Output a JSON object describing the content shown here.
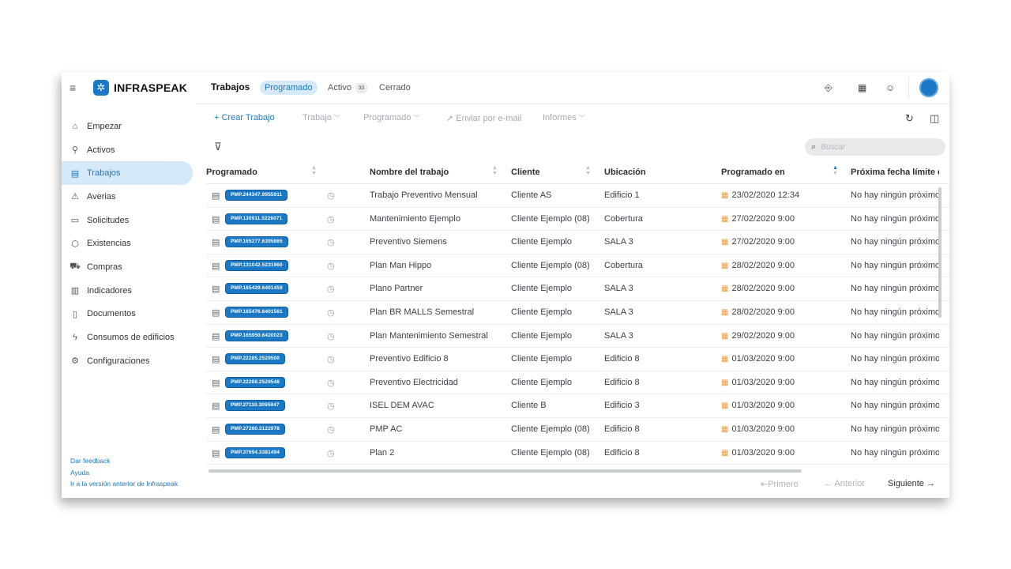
{
  "brand": {
    "name": "INFRASPEAK"
  },
  "sidebar": {
    "items": [
      {
        "label": "Empezar",
        "icon": "home-icon",
        "glyph": "⌂"
      },
      {
        "label": "Activos",
        "icon": "wrench-icon",
        "glyph": "⚲"
      },
      {
        "label": "Trabajos",
        "icon": "clipboard-icon",
        "glyph": "▤",
        "active": true
      },
      {
        "label": "Averias",
        "icon": "warning-icon",
        "glyph": "⚠"
      },
      {
        "label": "Solicitudes",
        "icon": "message-icon",
        "glyph": "▭"
      },
      {
        "label": "Existencias",
        "icon": "boxes-icon",
        "glyph": "⬡"
      },
      {
        "label": "Compras",
        "icon": "cart-icon",
        "glyph": "⛟"
      },
      {
        "label": "Indicadores",
        "icon": "bar-chart-icon",
        "glyph": "▥"
      },
      {
        "label": "Documentos",
        "icon": "document-icon",
        "glyph": "▯"
      },
      {
        "label": "Consumos de edificios",
        "icon": "lightning-icon",
        "glyph": "ϟ"
      },
      {
        "label": "Configuraciones",
        "icon": "gear-icon",
        "glyph": "⚙"
      }
    ],
    "footer": {
      "feedback": "Dar feedback",
      "help": "Ayuda",
      "previous_version": "Ir a la versión anterior de Infraspeak"
    }
  },
  "header": {
    "title": "Trabajos",
    "tabs": {
      "scheduled": "Programado",
      "active": "Activo",
      "active_count": "33",
      "closed": "Cerrado"
    }
  },
  "toolbar": {
    "create": "+ Crear Trabajo",
    "job": "Trabajo",
    "scheduled": "Programado",
    "email": "Enviar por e-mail",
    "reports": "Informes"
  },
  "search": {
    "placeholder": "Buscar"
  },
  "table": {
    "headers": {
      "scheduled": "Programado",
      "name": "Nombre del trabajo",
      "client": "Cliente",
      "location": "Ubicación",
      "scheduled_at": "Programado en",
      "next_deadline": "Próxima fecha límite de"
    },
    "rows": [
      {
        "code": "PMP.244347.9955911",
        "name": "Trabajo Preventivo Mensual",
        "client": "Cliente AS",
        "location": "Edificio 1",
        "date": "23/02/2020 12:34",
        "next": "No hay ningún próximo"
      },
      {
        "code": "PMP.130911.5226071",
        "name": "Mantenimiento Ejemplo",
        "client": "Cliente Ejemplo (08)",
        "location": "Cobertura",
        "date": "27/02/2020 9:00",
        "next": "No hay ningún próximo"
      },
      {
        "code": "PMP.165277.6395865",
        "name": "Preventivo Siemens",
        "client": "Cliente Ejemplo",
        "location": "SALA 3",
        "date": "27/02/2020 9:00",
        "next": "No hay ningún próximo"
      },
      {
        "code": "PMP.131042.5231960",
        "name": "Plan Man Hippo",
        "client": "Cliente Ejemplo (08)",
        "location": "Cobertura",
        "date": "28/02/2020 9:00",
        "next": "No hay ningún próximo"
      },
      {
        "code": "PMP.165429.6401459",
        "name": "Plano Partner",
        "client": "Cliente Ejemplo",
        "location": "SALA 3",
        "date": "28/02/2020 9:00",
        "next": "No hay ningún próximo"
      },
      {
        "code": "PMP.165476.6401561",
        "name": "Plan BR MALLS Semestral",
        "client": "Cliente Ejemplo",
        "location": "SALA 3",
        "date": "28/02/2020 9:00",
        "next": "No hay ningún próximo"
      },
      {
        "code": "PMP.165950.6420023",
        "name": "Plan Mantenimiento Semestral",
        "client": "Cliente Ejemplo",
        "location": "SALA 3",
        "date": "29/02/2020 9:00",
        "next": "No hay ningún próximo"
      },
      {
        "code": "PMP.22285.2529500",
        "name": "Preventivo Edificio 8",
        "client": "Cliente Ejemplo",
        "location": "Edificio 8",
        "date": "01/03/2020 9:00",
        "next": "No hay ningún próximo"
      },
      {
        "code": "PMP.22288.2529548",
        "name": "Preventivo Electricidad",
        "client": "Cliente Ejemplo",
        "location": "Edificio 8",
        "date": "01/03/2020 9:00",
        "next": "No hay ningún próximo"
      },
      {
        "code": "PMP.27110.3095947",
        "name": "ISEL DEM AVAC",
        "client": "Cliente B",
        "location": "Edificio 3",
        "date": "01/03/2020 9:00",
        "next": "No hay ningún próximo"
      },
      {
        "code": "PMP.27260.3122978",
        "name": "PMP AC",
        "client": "Cliente Ejemplo (08)",
        "location": "Edificio 8",
        "date": "01/03/2020 9:00",
        "next": "No hay ningún próximo"
      },
      {
        "code": "PMP.37694.3381494",
        "name": "Plan 2",
        "client": "Cliente Ejemplo (08)",
        "location": "Edificio 8",
        "date": "01/03/2020 9:00",
        "next": "No hay ningún próximo"
      }
    ]
  },
  "pagination": {
    "first": "⇤Primero",
    "previous": "← Anterior",
    "next": "Siguiente →"
  },
  "colors": {
    "accent": "#1b78c4",
    "accent_light": "#d6e9f8",
    "calendar": "#f39a3c"
  }
}
